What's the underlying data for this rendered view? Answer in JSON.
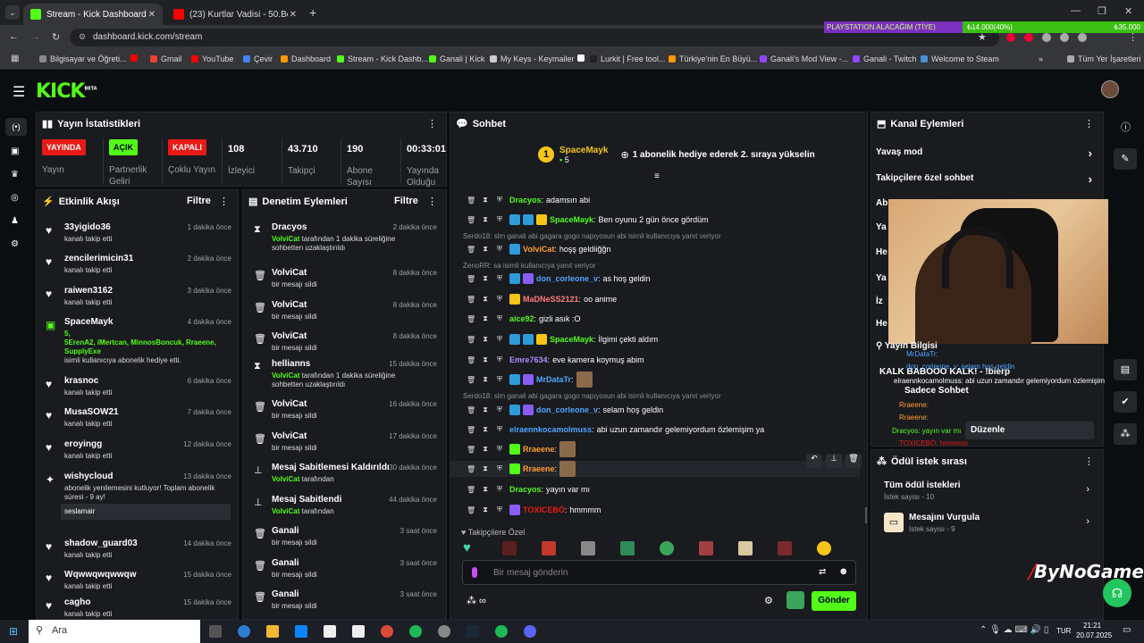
{
  "browser": {
    "tabs": [
      {
        "label": "Stream - Kick Dashboard",
        "active": true
      },
      {
        "label": "(23) Kurtlar Vadisi - 50.Bölüm | ..."
      }
    ],
    "url": "dashboard.kick.com/stream",
    "ad_left": "PLAYSTATION ALACAĞIM (TİYE)",
    "ad_mid": "₺14.000(40%)",
    "ad_right": "₺35.000",
    "bookmarks": [
      "Bilgisayar ve Öğreti...",
      "Gmail",
      "YouTube",
      "Çevir",
      "Dashboard",
      "Stream - Kick Dashb...",
      "Ganali | Kick",
      "My Keys - Keymailer",
      "Lurkit | Free tool...",
      "Türkiye'nin En Büyü...",
      "Ganali's Mod View -...",
      "Ganali - Twitch",
      "Welcome to Steam"
    ],
    "all_bookmarks": "Tüm Yer İşaretleri"
  },
  "app": {
    "logo": "KICK",
    "logo_sup": "BETA"
  },
  "stats": {
    "title": "Yayın İstatistikleri",
    "items": [
      {
        "value": "YAYINDA",
        "label": "Yayın",
        "type": "badge",
        "color": "#e91916"
      },
      {
        "value": "AÇIK",
        "label": "Partnerlik Geliri",
        "type": "badge",
        "color": "#53fc18"
      },
      {
        "value": "KAPALI",
        "label": "Çoklu Yayın",
        "type": "badge",
        "color": "#e91916"
      },
      {
        "value": "108",
        "label": "İzleyici"
      },
      {
        "value": "43.710",
        "label": "Takipçi"
      },
      {
        "value": "190",
        "label": "Abone Sayısı"
      },
      {
        "value": "00:33:01",
        "label": "Yayında Olduğu"
      }
    ]
  },
  "activity": {
    "title": "Etkinlik Akışı",
    "filter": "Filtre",
    "items": [
      {
        "name": "33yigido36",
        "desc": "kanalı takip etti",
        "time": "1 dakika önce"
      },
      {
        "name": "zencilerimicin31",
        "desc": "kanalı takip etti",
        "time": "2 dakika önce"
      },
      {
        "name": "raiwen3162",
        "desc": "kanalı takip etti",
        "time": "3 dakika önce"
      },
      {
        "name": "SpaceMayk",
        "desc": "isimli kullanıcıya abonelik hediye etti.",
        "time": "4 dakika önce",
        "extra1": "5,",
        "extra2": "5ErenA2, iMertcan, MinnosBoncuk, Rraeene,",
        "extra3": "SupplyExe"
      },
      {
        "name": "krasnoc",
        "desc": "kanalı takip etti",
        "time": "6 dakika önce"
      },
      {
        "name": "MusaSOW21",
        "desc": "kanalı takip etti",
        "time": "7 dakika önce"
      },
      {
        "name": "eroyingg",
        "desc": "kanalı takip etti",
        "time": "12 dakika önce"
      },
      {
        "name": "wishycloud",
        "desc": "abonelik yenilemesini kutluyor! Toplam abonelik süresi - 9 ay!",
        "time": "13 dakika önce",
        "msg": "seslamair"
      },
      {
        "name": "shadow_guard03",
        "desc": "kanalı takip etti",
        "time": "14 dakika önce"
      },
      {
        "name": "Wqwwqwqwwqw",
        "desc": "kanalı takip etti",
        "time": "15 dakika önce"
      },
      {
        "name": "cagho",
        "desc": "kanalı takip etti",
        "time": "15 dakika önce"
      }
    ]
  },
  "moderation": {
    "title": "Denetim Eylemleri",
    "filter": "Filtre",
    "items": [
      {
        "name": "Dracyos",
        "by": "VolviCat",
        "desc": " tarafından 1 dakika süreliğine sohbetten uzaklaştırıldı",
        "time": "2 dakika önce",
        "icon": "timeout"
      },
      {
        "name": "VolviCat",
        "desc": "bir mesajı sildi",
        "time": "8 dakika önce",
        "icon": "trash"
      },
      {
        "name": "VolviCat",
        "desc": "bir mesajı sildi",
        "time": "8 dakika önce",
        "icon": "trash"
      },
      {
        "name": "VolviCat",
        "desc": "bir mesajı sildi",
        "time": "8 dakika önce",
        "icon": "trash"
      },
      {
        "name": "hellianns",
        "by": "VolviCat",
        "desc": " tarafından 1 dakika süreliğine sohbetten uzaklaştırıldı",
        "time": "15 dakika önce",
        "icon": "timeout"
      },
      {
        "name": "VolviCat",
        "desc": "bir mesajı sildi",
        "time": "16 dakika önce",
        "icon": "trash"
      },
      {
        "name": "VolviCat",
        "desc": "bir mesajı sildi",
        "time": "17 dakika önce",
        "icon": "trash"
      },
      {
        "name": "Mesaj Sabitlemesi Kaldırıldı",
        "by": "VolviCat",
        "desc": " tarafından",
        "time": "30 dakika önce",
        "icon": "unpin"
      },
      {
        "name": "Mesaj Sabitlendi",
        "by": "VolviCat",
        "desc": " tarafından",
        "time": "44 dakika önce",
        "icon": "pin"
      },
      {
        "name": "Ganali",
        "desc": "bir mesajı sildi",
        "time": "3 saat önce",
        "icon": "trash"
      },
      {
        "name": "Ganali",
        "desc": "bir mesajı sildi",
        "time": "3 saat önce",
        "icon": "trash"
      },
      {
        "name": "Ganali",
        "desc": "bir mesajı sildi",
        "time": "3 saat önce",
        "icon": "trash"
      }
    ]
  },
  "chat": {
    "title": "Sohbet",
    "pinned": {
      "user": "SpaceMayk",
      "count": "5",
      "text": "1 abonelik hediye ederek 2. sıraya yükselin"
    },
    "lines": [
      {
        "user": "Dracyos",
        "color": "#53fc18",
        "text": "adamsın abi"
      },
      {
        "user": "SpaceMayk",
        "color": "#53fc18",
        "text": "Ben oyunu 2 gün önce gördüm",
        "badges": [
          "#2d9cdb",
          "#2d9cdb",
          "#f5c518"
        ]
      },
      {
        "reply": "Serdo18: slm ganali abi gagara gogo napıyosun abi isimli kullanıcıya yanıt veriyor"
      },
      {
        "user": "VolviCat",
        "color": "#ff9d2e",
        "text": "hoşş geldiiğğn",
        "badges": [
          "#2d9cdb"
        ]
      },
      {
        "reply": "ZenoRR: sa isimli kullanıcıya yanıt veriyor"
      },
      {
        "user": "don_corleone_v",
        "color": "#4da6ff",
        "text": "as hoş geldin",
        "badges": [
          "#2d9cdb",
          "#8a5cf6"
        ]
      },
      {
        "user": "MaDNeSS2121",
        "color": "#ff7b7b",
        "text": "oo anime",
        "badges": [
          "#f5c518"
        ]
      },
      {
        "user": "aice92",
        "color": "#53fc18",
        "text": "gizli asık :O"
      },
      {
        "user": "SpaceMayk",
        "color": "#53fc18",
        "text": "İlgimi çekti aldım",
        "badges": [
          "#2d9cdb",
          "#2d9cdb",
          "#f5c518"
        ]
      },
      {
        "user": "Emre7634",
        "color": "#b18cff",
        "text": "eve kamera koymuş abim"
      },
      {
        "user": "MrDataTr",
        "color": "#4da6ff",
        "text": "",
        "badges": [
          "#2d9cdb",
          "#8a5cf6"
        ],
        "emote": true
      },
      {
        "reply": "Serdo18: slm ganali abi gagara gogo napıyosun abi isimli kullanıcıya yanıt veriyor"
      },
      {
        "user": "don_corleone_v",
        "color": "#4da6ff",
        "text": "selam hoş geldin",
        "badges": [
          "#2d9cdb",
          "#8a5cf6"
        ]
      },
      {
        "user": "elraennkocamolmuss",
        "color": "#4da6ff",
        "text": "abi uzun zamandır gelemiyordum özlemişim ya"
      },
      {
        "user": "Rraeene",
        "color": "#ff9d2e",
        "text": "",
        "badges": [
          "#53fc18"
        ],
        "emote": true
      },
      {
        "user": "Rraeene",
        "color": "#ff9d2e",
        "text": "",
        "badges": [
          "#53fc18"
        ],
        "emote": true,
        "hover": true
      },
      {
        "user": "Dracyos",
        "color": "#53fc18",
        "text": "yayın var mı"
      },
      {
        "user": "TOXICEBÖ",
        "color": "#e91916",
        "text": "hmmmm",
        "badges": [
          "#8a5cf6"
        ]
      }
    ],
    "followers_only": "Takipçilere Özel",
    "input_placeholder": "Bir mesaj gönderin",
    "send": "Gönder"
  },
  "channel": {
    "title": "Kanal Eylemleri",
    "items": [
      "Yavaş mod",
      "Takipçilere özel sohbet",
      "Ab",
      "Ya",
      "He",
      "Ya",
      "İz",
      "He"
    ],
    "stream_info": "Yayın Bilgisi",
    "overlay_title": "KALK BABOOO KALK! - !bierp",
    "overlay_lines": [
      "MrDataTr:",
      "don_corleone_v: selam hoş geldin",
      "elraennkocamolmuss: abi uzun zamandır gelemiyordum özlemişim",
      "Sadece Sohbet",
      "Rraeene:",
      "Rraeene:",
      "Dracyos: yayın var mı",
      "TOXICEBÖ: hmmmm"
    ],
    "edit": "Düzenle"
  },
  "rewards": {
    "title": "Ödül istek sırası",
    "items": [
      {
        "label": "Tüm ödül istekleri",
        "count": "İstek sayısı - 10"
      },
      {
        "label": "Mesajını Vurgula",
        "count": "İstek sayısı - 9"
      }
    ]
  },
  "watermark": "ByNoGame",
  "taskbar": {
    "search": "Ara",
    "lang": "TUR",
    "time": "21:21",
    "date": "20.07.2025"
  }
}
